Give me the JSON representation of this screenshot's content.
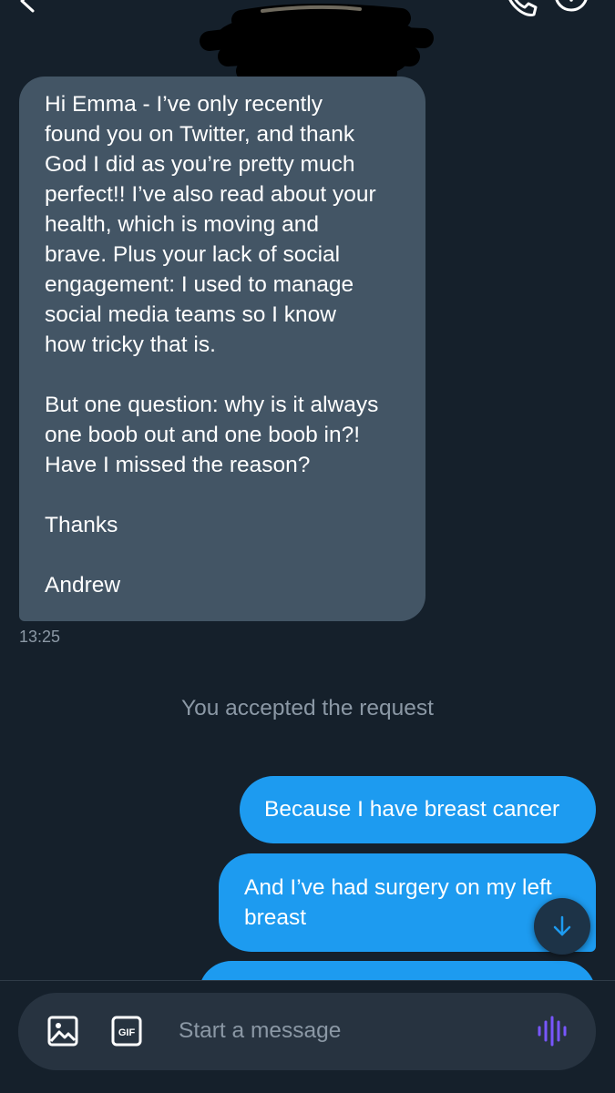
{
  "header": {
    "back_icon": "chevron-left-icon",
    "call_icon": "phone-icon",
    "info_icon": "info-icon"
  },
  "conversation": {
    "received": {
      "paragraphs": [
        "Hi Emma - I’ve only recently\nfound you on Twitter, and thank\nGod I did as you’re pretty much\nperfect!! I’ve also read about your\nhealth, which is moving and\nbrave. Plus your lack of social\nengagement: I used to manage\nsocial media teams so I know\nhow tricky that is.",
        "But one question: why is it always\none boob out and one boob in?!\nHave I missed the reason?",
        "Thanks",
        "Andrew"
      ],
      "timestamp": "13:25"
    },
    "system_notice": "You accepted the request",
    "sent": [
      "Because I have breast cancer",
      "And I’ve had surgery on my left\nbreast"
    ],
    "scroll_down_icon": "arrow-down-icon"
  },
  "composer": {
    "placeholder": "Start a message",
    "image_icon": "image-icon",
    "gif_icon": "gif-icon",
    "gif_label": "GIF",
    "voice_icon": "voice-waveform-icon"
  },
  "colors": {
    "background": "#15202b",
    "received_bubble": "#435565",
    "sent_bubble": "#1d9bf0",
    "muted_text": "#8b98a5",
    "composer": "#273340",
    "voice_accent": "#7856ff"
  }
}
